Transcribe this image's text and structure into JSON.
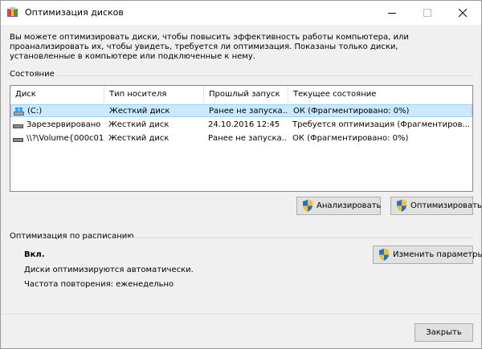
{
  "window": {
    "title": "Оптимизация дисков"
  },
  "description": "Вы можете оптимизировать диски, чтобы повысить эффективность работы  компьютера, или проанализировать их, чтобы увидеть, требуется ли оптимизация. Показаны только диски, установленные в компьютере или подключенные к нему.",
  "status_section": {
    "label": "Состояние",
    "columns": [
      "Диск",
      "Тип носителя",
      "Прошлый запуск",
      "Текущее состояние"
    ],
    "rows": [
      {
        "drive": "(C:)",
        "media": "Жесткий диск",
        "last_run": "Ранее не запуска...",
        "status": "ОК (Фрагментировано: 0%)",
        "selected": true,
        "icon": "windows-drive-icon"
      },
      {
        "drive": "Зарезервировано ...",
        "media": "Жесткий диск",
        "last_run": "24.10.2016 12:45",
        "status": "Требуется оптимизация (Фрагментиров...",
        "selected": false,
        "icon": "hard-drive-icon"
      },
      {
        "drive": "\\\\?\\Volume{000c01...",
        "media": "Жесткий диск",
        "last_run": "Ранее не запуска...",
        "status": "ОК (Фрагментировано: 0%)",
        "selected": false,
        "icon": "hard-drive-icon"
      }
    ]
  },
  "buttons": {
    "analyze": "Анализировать",
    "optimize": "Оптимизировать",
    "change_settings": "Изменить параметры",
    "close": "Закрыть"
  },
  "schedule_section": {
    "label": "Оптимизация по расписанию",
    "state": "Вкл.",
    "auto_text": "Диски оптимизируются автоматически.",
    "frequency_text": "Частота повторения: еженедельно"
  },
  "colors": {
    "selection": "#cce8ff",
    "selection_border": "#99d1ff",
    "button_face": "#e1e1e1",
    "window_bg": "#f0f0f0"
  }
}
